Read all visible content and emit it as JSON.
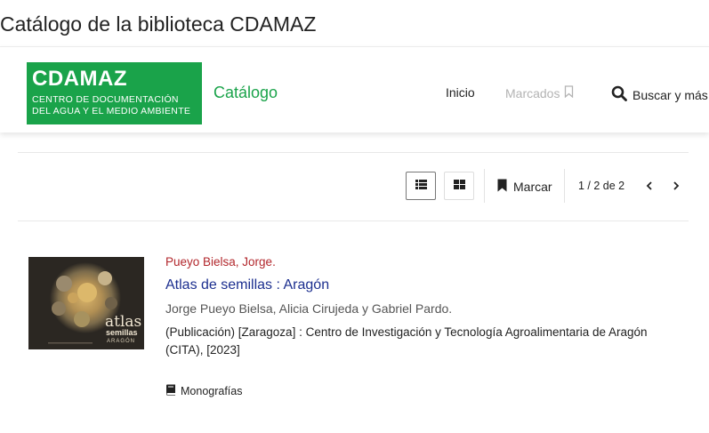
{
  "page": {
    "title": "Catálogo de la biblioteca CDAMAZ"
  },
  "header": {
    "logo": {
      "name": "CDAMAZ",
      "line1": "CENTRO DE DOCUMENTACIÓN",
      "line2": "DEL AGUA Y EL MEDIO AMBIENTE"
    },
    "brand": "Catálogo",
    "nav": {
      "home": "Inicio",
      "bookmarks": "Marcados",
      "search": "Buscar y más"
    }
  },
  "toolbar": {
    "bookmark_label": "Marcar",
    "pager_text": "1 / 2 de 2",
    "active_view": "list"
  },
  "record": {
    "author": "Pueyo Bielsa, Jorge.",
    "title": "Atlas de semillas : Aragón",
    "responsibility": "Jorge Pueyo Bielsa, Alicia Cirujeda y Gabriel Pardo.",
    "publication": "(Publicación) [Zaragoza] : Centro de Investigación y Tecnología Agroalimentaria de Aragón (CITA), [2023]",
    "format": "Monografías",
    "cover": {
      "word1": "atlas",
      "word2": "semillas",
      "word3": "ARAGÓN"
    }
  },
  "colors": {
    "brand": "#1aa34a",
    "author": "#b2272c",
    "title": "#1c2f8f",
    "disabled": "#b3b3b3"
  }
}
